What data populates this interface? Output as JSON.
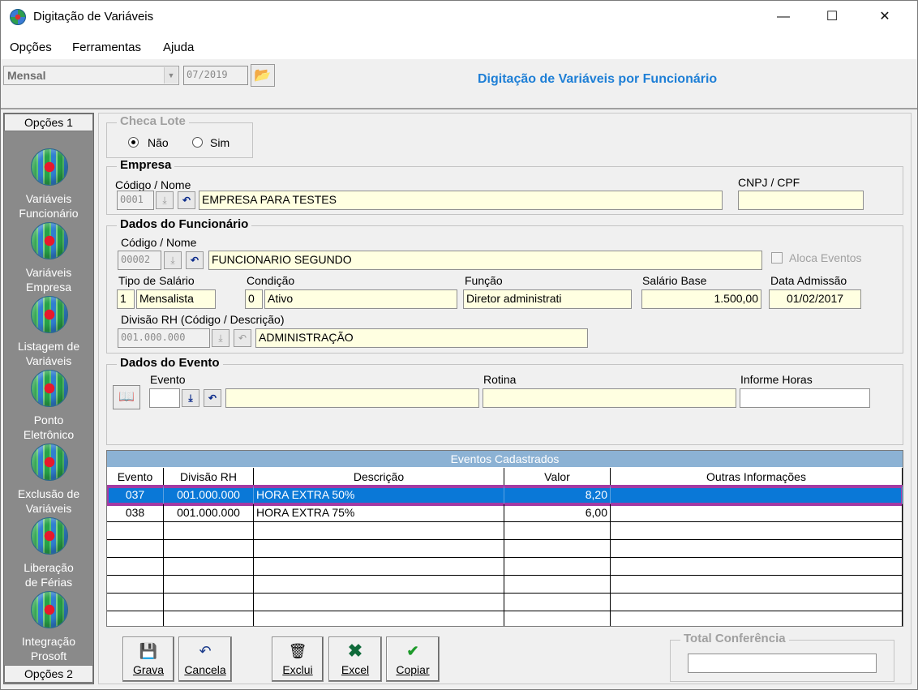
{
  "window": {
    "title": "Digitação de Variáveis",
    "minimize": "—",
    "maximize": "☐",
    "close": "✕"
  },
  "menu": [
    "Opções",
    "Ferramentas",
    "Ajuda"
  ],
  "toolbar": {
    "period_type": "Mensal",
    "period": "07/2019",
    "header_title": "Digitação de Variáveis por Funcionário"
  },
  "sidebar": {
    "top_header": "Opções 1",
    "bottom_header": "Opções 2",
    "items": [
      {
        "line1": "Variáveis",
        "line2": "Funcionário"
      },
      {
        "line1": "Variáveis",
        "line2": "Empresa"
      },
      {
        "line1": "Listagem de",
        "line2": "Variáveis"
      },
      {
        "line1": "Ponto",
        "line2": "Eletrônico"
      },
      {
        "line1": "Exclusão de",
        "line2": "Variáveis"
      },
      {
        "line1": "Liberação",
        "line2": "de Férias"
      },
      {
        "line1": "Integração",
        "line2": "Prosoft"
      }
    ]
  },
  "checa_lote": {
    "legend": "Checa Lote",
    "option_nao": "Não",
    "option_sim": "Sim",
    "selected": "Não"
  },
  "empresa": {
    "legend": "Empresa",
    "codigo_nome_label": "Código / Nome",
    "codigo": "0001",
    "nome": "EMPRESA PARA TESTES",
    "cnpj_label": "CNPJ / CPF",
    "cnpj": ""
  },
  "funcionario": {
    "legend": "Dados do Funcionário",
    "codigo_nome_label": "Código / Nome",
    "codigo": "00002",
    "nome": "FUNCIONARIO SEGUNDO",
    "aloca_label": "Aloca Eventos",
    "tipo_salario_label": "Tipo de Salário",
    "tipo_salario_cod": "1",
    "tipo_salario": "Mensalista",
    "condicao_label": "Condição",
    "condicao_cod": "0",
    "condicao": "Ativo",
    "funcao_label": "Função",
    "funcao": "Diretor administrati",
    "salario_label": "Salário Base",
    "salario": "1.500,00",
    "admissao_label": "Data Admissão",
    "admissao": "01/02/2017",
    "divisao_label": "Divisão RH (Código / Descrição)",
    "divisao_cod": "001.000.000",
    "divisao": "ADMINISTRAÇÃO"
  },
  "evento": {
    "legend": "Dados do Evento",
    "evento_label": "Evento",
    "rotina_label": "Rotina",
    "horas_label": "Informe Horas"
  },
  "grid": {
    "caption": "Eventos Cadastrados",
    "columns": [
      "Evento",
      "Divisão RH",
      "Descrição",
      "Valor",
      "Outras Informações"
    ],
    "rows": [
      {
        "evento": "037",
        "divisao": "001.000.000",
        "descricao": "HORA EXTRA 50%",
        "valor": "8,20",
        "outras": ""
      },
      {
        "evento": "038",
        "divisao": "001.000.000",
        "descricao": "HORA EXTRA 75%",
        "valor": "6,00",
        "outras": ""
      }
    ]
  },
  "buttons": {
    "grava": "Grava",
    "cancela": "Cancela",
    "exclui": "Exclui",
    "excel": "Excel",
    "copiar": "Copiar"
  },
  "total": {
    "legend": "Total Conferência",
    "value": ""
  },
  "colors": {
    "accent_title": "#1e7fd6",
    "selection": "#0a78d7",
    "selection_outline": "#a33aa3",
    "field_bg": "#ffffe1",
    "grid_caption": "#8cb2d4"
  }
}
